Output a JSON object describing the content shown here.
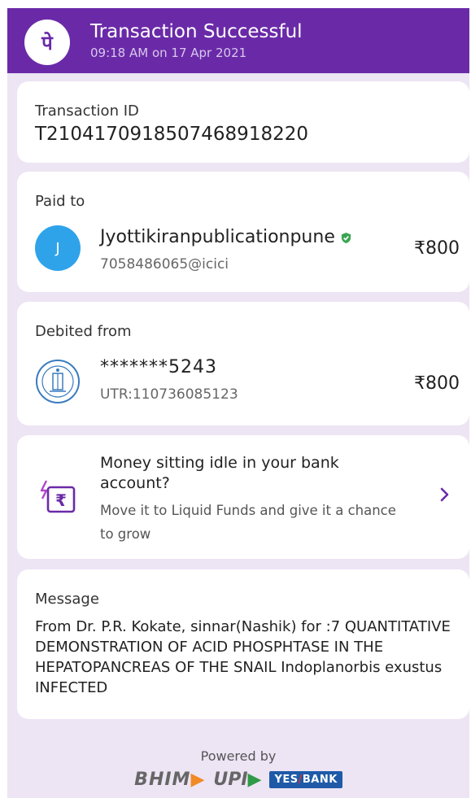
{
  "header": {
    "logo_char": "पे",
    "title": "Transaction Successful",
    "subtitle": "09:18 AM on 17 Apr 2021",
    "bg_color": "#6a2aa8"
  },
  "transaction": {
    "label": "Transaction ID",
    "id": "T2104170918507468918220"
  },
  "paid_to": {
    "label": "Paid to",
    "avatar_initial": "J",
    "name": "Jyottikiranpublicationpune",
    "vpa": "7058486065@icici",
    "amount": "₹800",
    "verified_icon": "verified-shield-icon"
  },
  "debited_from": {
    "label": "Debited from",
    "account": "*******5243",
    "utr": "UTR:110736085123",
    "amount": "₹800",
    "bank_icon": "bank-seal-icon"
  },
  "promo": {
    "title": "Money sitting idle in your bank account?",
    "body": "Move it to Liquid Funds and give it a chance to grow",
    "icon": "rupee-wallet-icon"
  },
  "message": {
    "label": "Message",
    "text": "From Dr. P.R. Kokate, sinnar(Nashik) for :7 QUANTITATIVE  DEMONSTRATION  OF  ACID PHOSPHTASE  IN THE HEPATOPANCREAS OF THE SNAIL Indoplanorbis exustus INFECTED"
  },
  "footer": {
    "powered_by": "Powered by",
    "bhim": "BHIM",
    "upi": "UPI",
    "yes": "YES",
    "bank": "BANK"
  }
}
